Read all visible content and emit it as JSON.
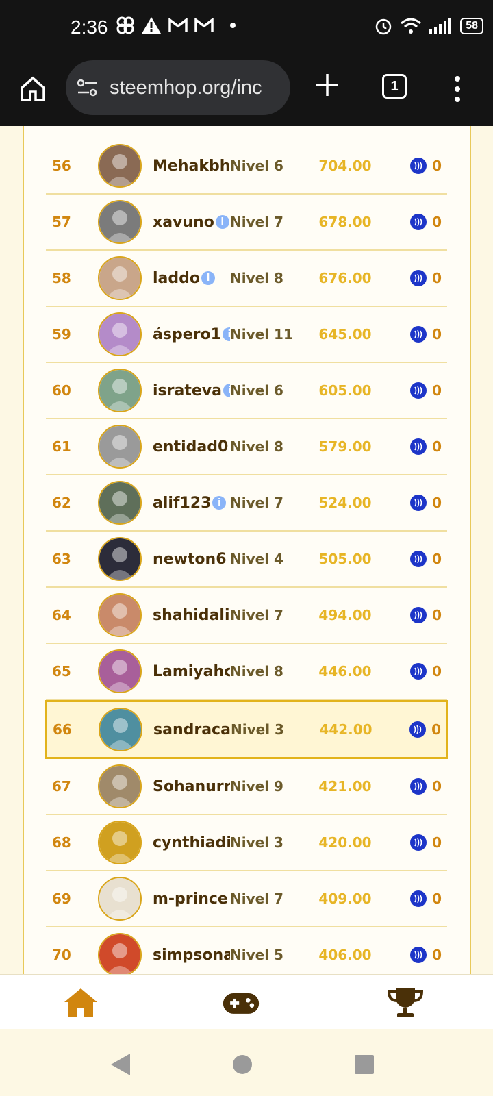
{
  "status_bar": {
    "time": "2:36",
    "battery": "58",
    "icons_left": [
      "pinwheel-icon",
      "warning-icon",
      "gmail-icon",
      "gmail-icon",
      "dot-icon"
    ],
    "icons_right": [
      "alarm-icon",
      "wifi-icon",
      "signal-icon",
      "battery-icon"
    ]
  },
  "browser": {
    "url": "steemhop.org/inc",
    "tab_count": "1"
  },
  "leaderboard": {
    "rows": [
      {
        "rank": "56",
        "name": "Mehakbh",
        "info": false,
        "level": "Nivel 6",
        "score": "704.00",
        "coins": "0",
        "avatar_color": "#8a6a54"
      },
      {
        "rank": "57",
        "name": "xavuno",
        "info": true,
        "level": "Nivel 7",
        "score": "678.00",
        "coins": "0",
        "avatar_color": "#7b7b7b"
      },
      {
        "rank": "58",
        "name": "laddo",
        "info": true,
        "level": "Nivel 8",
        "score": "676.00",
        "coins": "0",
        "avatar_color": "#c9a68a"
      },
      {
        "rank": "59",
        "name": "áspero1",
        "info": true,
        "level": "Nivel 11",
        "score": "645.00",
        "coins": "0",
        "avatar_color": "#b48bc9"
      },
      {
        "rank": "60",
        "name": "israteva",
        "info": true,
        "level": "Nivel 6",
        "score": "605.00",
        "coins": "0",
        "avatar_color": "#7fa38a"
      },
      {
        "rank": "61",
        "name": "entidad0",
        "info": false,
        "level": "Nivel 8",
        "score": "579.00",
        "coins": "0",
        "avatar_color": "#9a9a9a"
      },
      {
        "rank": "62",
        "name": "alif123",
        "info": true,
        "level": "Nivel 7",
        "score": "524.00",
        "coins": "0",
        "avatar_color": "#5f6f5a"
      },
      {
        "rank": "63",
        "name": "newton6",
        "info": false,
        "level": "Nivel 4",
        "score": "505.00",
        "coins": "0",
        "avatar_color": "#2c2c3a"
      },
      {
        "rank": "64",
        "name": "shahidali",
        "info": false,
        "level": "Nivel 7",
        "score": "494.00",
        "coins": "0",
        "avatar_color": "#c98a6a"
      },
      {
        "rank": "65",
        "name": "Lamiyahc",
        "info": false,
        "level": "Nivel 8",
        "score": "446.00",
        "coins": "0",
        "avatar_color": "#a85f9a"
      },
      {
        "rank": "66",
        "name": "sandraca",
        "info": false,
        "level": "Nivel 3",
        "score": "442.00",
        "coins": "0",
        "avatar_color": "#4f8fa0",
        "highlight": true
      },
      {
        "rank": "67",
        "name": "Sohanurr",
        "info": false,
        "level": "Nivel 9",
        "score": "421.00",
        "coins": "0",
        "avatar_color": "#a08a6a"
      },
      {
        "rank": "68",
        "name": "cynthiadi",
        "info": false,
        "level": "Nivel 3",
        "score": "420.00",
        "coins": "0",
        "avatar_color": "#d0a020"
      },
      {
        "rank": "69",
        "name": "m-prince",
        "info": false,
        "level": "Nivel 7",
        "score": "409.00",
        "coins": "0",
        "avatar_color": "#e8e0d0"
      },
      {
        "rank": "70",
        "name": "simpsona",
        "info": false,
        "level": "Nivel 5",
        "score": "406.00",
        "coins": "0",
        "avatar_color": "#d04a2a"
      }
    ]
  },
  "bottom_nav": {
    "items": [
      "home-icon",
      "gamepad-icon",
      "trophy-icon"
    ]
  }
}
